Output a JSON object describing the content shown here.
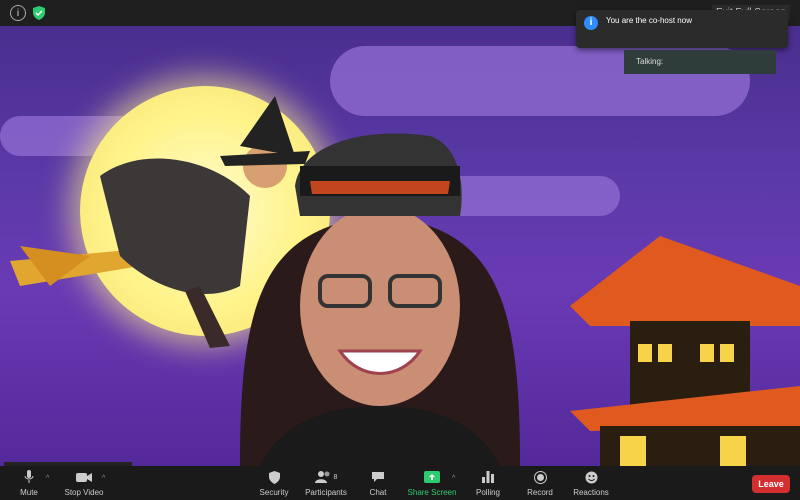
{
  "topbar": {
    "exit_fullscreen_label": "Exit Full Screen"
  },
  "notification": {
    "text": "You are the co-host now"
  },
  "talking": {
    "label": "Talking:"
  },
  "toolbar": {
    "mute": "Mute",
    "stop_video": "Stop Video",
    "security": "Security",
    "participants": "Participants",
    "participants_count": "8",
    "chat": "Chat",
    "share_screen": "Share Screen",
    "polling": "Polling",
    "record": "Record",
    "reactions": "Reactions",
    "leave": "Leave"
  },
  "colors": {
    "leave": "#d32f2f",
    "share_green": "#2ecc71",
    "info_blue": "#2f8cff"
  }
}
